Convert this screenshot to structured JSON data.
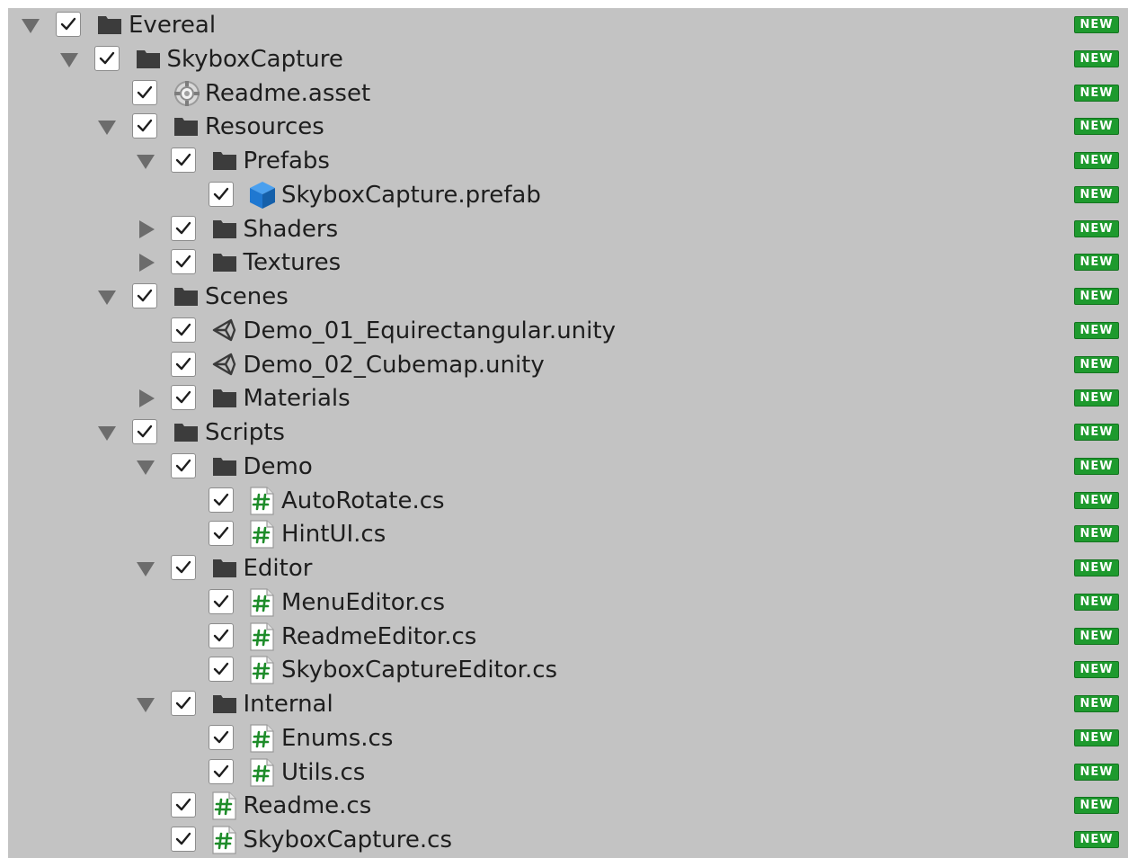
{
  "colors": {
    "panel_background": "#c3c3c3",
    "badge_background": "#1e9a2e",
    "folder_icon": "#3c3c3c",
    "prefab_icon": "#1f78d1",
    "script_hash": "#1e8c2a"
  },
  "badge_label": "NEW",
  "items": [
    {
      "label": "Evereal",
      "depth": 0,
      "icon": "folder-icon",
      "foldout": "open",
      "checked": true
    },
    {
      "label": "SkyboxCapture",
      "depth": 1,
      "icon": "folder-icon",
      "foldout": "open",
      "checked": true
    },
    {
      "label": "Readme.asset",
      "depth": 2,
      "icon": "settings-asset-icon",
      "foldout": "none",
      "checked": true
    },
    {
      "label": "Resources",
      "depth": 2,
      "icon": "folder-icon",
      "foldout": "open",
      "checked": true
    },
    {
      "label": "Prefabs",
      "depth": 3,
      "icon": "folder-icon",
      "foldout": "open",
      "checked": true
    },
    {
      "label": "SkyboxCapture.prefab",
      "depth": 4,
      "icon": "prefab-cube-icon",
      "foldout": "none",
      "checked": true
    },
    {
      "label": "Shaders",
      "depth": 3,
      "icon": "folder-icon",
      "foldout": "closed",
      "checked": true
    },
    {
      "label": "Textures",
      "depth": 3,
      "icon": "folder-icon",
      "foldout": "closed",
      "checked": true
    },
    {
      "label": "Scenes",
      "depth": 2,
      "icon": "folder-icon",
      "foldout": "open",
      "checked": true
    },
    {
      "label": "Demo_01_Equirectangular.unity",
      "depth": 3,
      "icon": "unity-scene-icon",
      "foldout": "none",
      "checked": true
    },
    {
      "label": "Demo_02_Cubemap.unity",
      "depth": 3,
      "icon": "unity-scene-icon",
      "foldout": "none",
      "checked": true
    },
    {
      "label": "Materials",
      "depth": 3,
      "icon": "folder-icon",
      "foldout": "closed",
      "checked": true
    },
    {
      "label": "Scripts",
      "depth": 2,
      "icon": "folder-icon",
      "foldout": "open",
      "checked": true
    },
    {
      "label": "Demo",
      "depth": 3,
      "icon": "folder-icon",
      "foldout": "open",
      "checked": true
    },
    {
      "label": "AutoRotate.cs",
      "depth": 4,
      "icon": "csharp-script-icon",
      "foldout": "none",
      "checked": true
    },
    {
      "label": "HintUI.cs",
      "depth": 4,
      "icon": "csharp-script-icon",
      "foldout": "none",
      "checked": true
    },
    {
      "label": "Editor",
      "depth": 3,
      "icon": "folder-icon",
      "foldout": "open",
      "checked": true
    },
    {
      "label": "MenuEditor.cs",
      "depth": 4,
      "icon": "csharp-script-icon",
      "foldout": "none",
      "checked": true
    },
    {
      "label": "ReadmeEditor.cs",
      "depth": 4,
      "icon": "csharp-script-icon",
      "foldout": "none",
      "checked": true
    },
    {
      "label": "SkyboxCaptureEditor.cs",
      "depth": 4,
      "icon": "csharp-script-icon",
      "foldout": "none",
      "checked": true
    },
    {
      "label": "Internal",
      "depth": 3,
      "icon": "folder-icon",
      "foldout": "open",
      "checked": true
    },
    {
      "label": "Enums.cs",
      "depth": 4,
      "icon": "csharp-script-icon",
      "foldout": "none",
      "checked": true
    },
    {
      "label": "Utils.cs",
      "depth": 4,
      "icon": "csharp-script-icon",
      "foldout": "none",
      "checked": true
    },
    {
      "label": "Readme.cs",
      "depth": 3,
      "icon": "csharp-script-icon",
      "foldout": "none",
      "checked": true
    },
    {
      "label": "SkyboxCapture.cs",
      "depth": 3,
      "icon": "csharp-script-icon",
      "foldout": "none",
      "checked": true
    }
  ]
}
